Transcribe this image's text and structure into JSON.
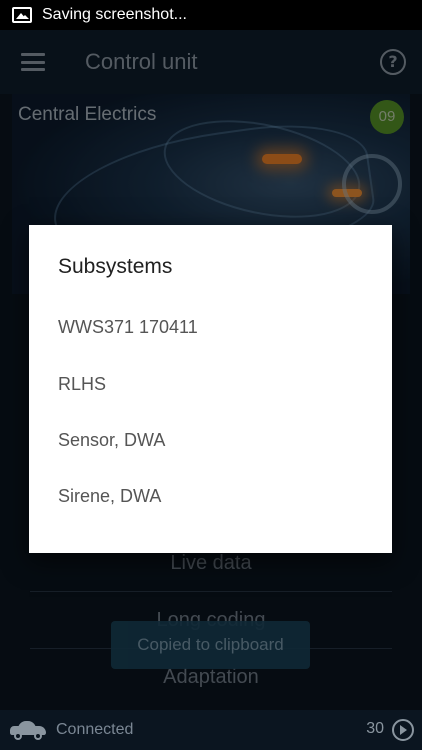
{
  "status_bar": {
    "notification": "Saving screenshot..."
  },
  "app_bar": {
    "title": "Control unit"
  },
  "banner": {
    "title": "Central Electrics",
    "badge": "09"
  },
  "menu": {
    "items": [
      {
        "label": "Live data"
      },
      {
        "label": "Long coding"
      },
      {
        "label": "Adaptation"
      }
    ]
  },
  "toast": {
    "text": "Copied to clipboard"
  },
  "dialog": {
    "title": "Subsystems",
    "items": [
      {
        "label": "WWS371 170411"
      },
      {
        "label": "RLHS"
      },
      {
        "label": "Sensor, DWA"
      },
      {
        "label": "Sirene, DWA"
      }
    ]
  },
  "bottom_bar": {
    "status": "Connected",
    "count": "30"
  },
  "colors": {
    "badge": "#5d9f2a",
    "accent_glow": "#ff8a2a",
    "toast_bg": "#1d4a63"
  }
}
